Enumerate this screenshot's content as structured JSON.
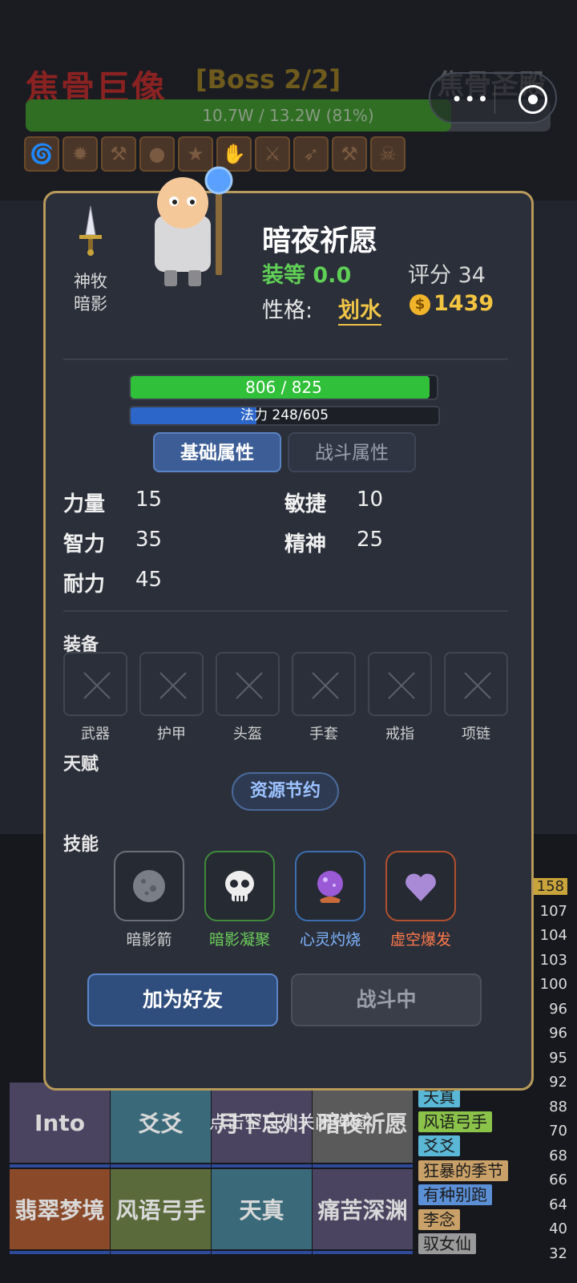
{
  "boss": {
    "name": "焦骨巨像",
    "tag": "[Boss 2/2]",
    "area": "焦骨圣殿",
    "hp_text": "10.7W / 13.2W (81%)",
    "hp_ratio": 0.81,
    "buff_icons": [
      "tornado-icon",
      "fire-icon",
      "hammer-icon",
      "orb-icon",
      "star-icon",
      "hand-icon",
      "swords-icon",
      "feather-icon",
      "hammer-icon",
      "skull-icon"
    ]
  },
  "capsule": {
    "menu_icon": "more-dots-icon",
    "close_icon": "target-circle-icon"
  },
  "background": {
    "tiles": [
      "Into",
      "爻爻",
      "月下忘川",
      "暗夜祈愿",
      "翡翠梦境",
      "风语弓手",
      "天真",
      "痛苦深渊"
    ],
    "rank_names": [
      {
        "name": "天真",
        "color": "#5bb7d6"
      },
      {
        "name": "风语弓手",
        "color": "#8bc34a"
      },
      {
        "name": "爻爻",
        "color": "#5bb7d6"
      },
      {
        "name": "狂暴的季节",
        "color": "#c8a068"
      },
      {
        "name": "有种别跑",
        "color": "#5b8fd6"
      },
      {
        "name": "李念",
        "color": "#c8a068"
      },
      {
        "name": "驭女仙",
        "color": "#9a9a9a"
      }
    ],
    "scores": [
      "158",
      "107",
      "104",
      "103",
      "100",
      "96",
      "96",
      "95",
      "92",
      "88",
      "70",
      "68",
      "66",
      "64",
      "40",
      "32"
    ],
    "close_hint": "点击空白处关闭弹窗"
  },
  "character": {
    "class_name": "神牧\n暗影",
    "class_line1": "神牧",
    "class_line2": "暗影",
    "name": "暗夜祈愿",
    "gear_label": "装等 0.0",
    "score_label": "评分 34",
    "nature_label": "性格:",
    "nature_value": "划水",
    "coins": "1439",
    "coin_icon": "$"
  },
  "bars": {
    "hp_text": "806 / 825",
    "hp_ratio": 0.977,
    "mp_text": "法力 248/605",
    "mp_ratio": 0.41
  },
  "tabs": {
    "basic": "基础属性",
    "battle": "战斗属性"
  },
  "stats": {
    "strength": {
      "label": "力量",
      "value": "15"
    },
    "agility": {
      "label": "敏捷",
      "value": "10"
    },
    "intellect": {
      "label": "智力",
      "value": "35"
    },
    "spirit": {
      "label": "精神",
      "value": "25"
    },
    "stamina": {
      "label": "耐力",
      "value": "45"
    }
  },
  "equipment": {
    "title": "装备",
    "slots": [
      "武器",
      "护甲",
      "头盔",
      "手套",
      "戒指",
      "项链"
    ]
  },
  "talent": {
    "title": "天赋",
    "value": "资源节约"
  },
  "skills": {
    "title": "技能",
    "items": [
      {
        "name": "暗影箭",
        "icon": "moon-icon",
        "color": "#cfcfcf",
        "border": "#6a6e78"
      },
      {
        "name": "暗影凝聚",
        "icon": "skull-icon",
        "color": "#6ccf5a",
        "border": "#3f8a3a"
      },
      {
        "name": "心灵灼烧",
        "icon": "crystal-ball-icon",
        "color": "#7fb6ff",
        "border": "#3d6fb0"
      },
      {
        "name": "虚空爆发",
        "icon": "heart-icon",
        "color": "#ff7a4a",
        "border": "#b0502e"
      }
    ]
  },
  "buttons": {
    "add_friend": "加为好友",
    "in_battle": "战斗中"
  }
}
